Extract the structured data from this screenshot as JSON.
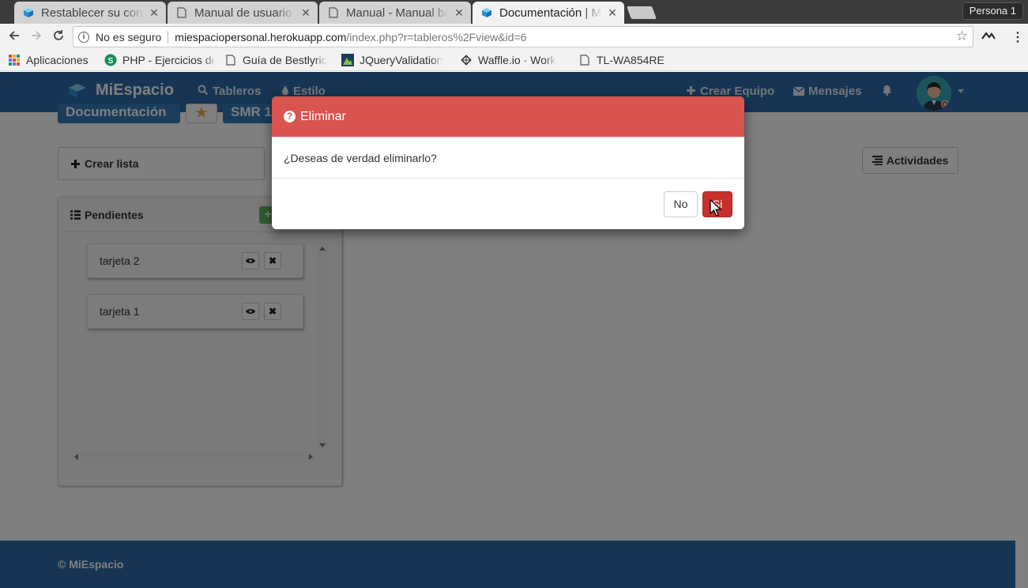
{
  "browser": {
    "tabs": [
      {
        "title": "Restablecer su contraseña",
        "active": false,
        "icon": "cube-favicon"
      },
      {
        "title": "Manual de usuario",
        "active": false,
        "icon": "page-icon"
      },
      {
        "title": "Manual - Manual básico",
        "active": false,
        "icon": "page-icon"
      },
      {
        "title": "Documentación | MiEspacio",
        "active": true,
        "icon": "cube-favicon"
      }
    ],
    "close_glyph": "✕",
    "profile": "Persona 1",
    "omnibox": {
      "security": "No es seguro",
      "host": "miespaciopersonal.herokuapp.com",
      "path": "/index.php?r=tableros%2Fview&id=6"
    },
    "bookmarks": [
      {
        "label": "Aplicaciones",
        "icon": "apps-icon"
      },
      {
        "label": "PHP - Ejercicios de",
        "icon": "php-icon"
      },
      {
        "label": "Guía de Bestlyric",
        "icon": "page-icon"
      },
      {
        "label": "JQueryValidation",
        "icon": "jquery-icon"
      },
      {
        "label": "Waffle.io · Work",
        "icon": "waffle-icon"
      },
      {
        "label": "TL-WA854RE",
        "icon": "page-icon"
      }
    ]
  },
  "navbar": {
    "brand": "MiEspacio",
    "items": [
      {
        "label": "Tableros",
        "icon": "search-icon"
      },
      {
        "label": "Estilo",
        "icon": "tint-icon"
      }
    ],
    "right_items": [
      {
        "label": "Crear Equipo",
        "icon": "plus-icon"
      },
      {
        "label": "Mensajes",
        "icon": "envelope-icon"
      }
    ]
  },
  "board": {
    "title_button": "Documentación",
    "star_glyph": "★",
    "team_button": "SMR 1",
    "create_list": "Crear lista",
    "activities": "Actividades",
    "list": {
      "title": "Pendientes",
      "add_glyph": "+",
      "cards": [
        {
          "title": "tarjeta 2"
        },
        {
          "title": "tarjeta 1"
        }
      ]
    }
  },
  "footer": {
    "text": "© MiEspacio"
  },
  "modal": {
    "title": "Eliminar",
    "message": "¿Deseas de verdad eliminarlo?",
    "no_label": "No",
    "yes_label": "Si"
  },
  "colors": {
    "navbar": "#2c6ba8",
    "danger": "#d9534f",
    "danger_active": "#c9302c",
    "success": "#5cb85c"
  }
}
